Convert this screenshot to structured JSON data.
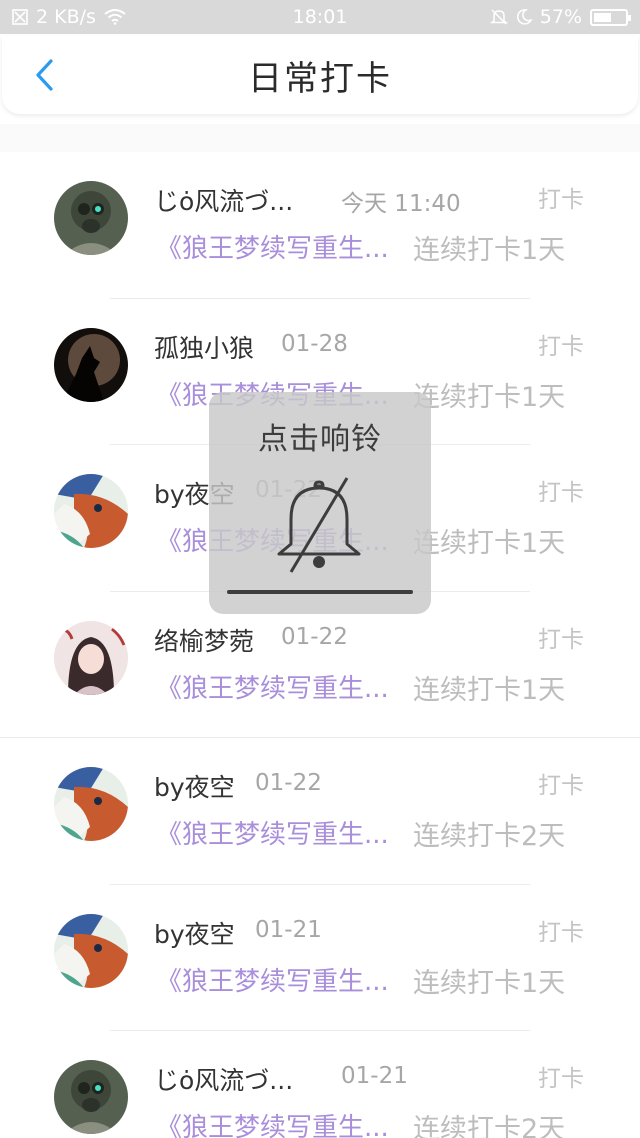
{
  "status_bar": {
    "network_speed": "2 KB/s",
    "time": "18:01",
    "battery_percent": "57%",
    "battery_level": 0.57,
    "icons": [
      "sim-off-icon",
      "wifi-icon",
      "bell-off-icon",
      "moon-icon",
      "battery-icon"
    ]
  },
  "header": {
    "title": "日常打卡",
    "back_icon": "chevron-left-icon",
    "accent_color": "#2a9bef"
  },
  "checkins": [
    {
      "name": "じȯ风流づ...",
      "time": "今天 11:40",
      "action": "打卡",
      "book": "《狼王梦续写重生...",
      "streak": "连续打卡1天",
      "avatar": "gasmask"
    },
    {
      "name": "孤独小狼",
      "time": "01-28",
      "action": "打卡",
      "book": "《狼王梦续写重生...",
      "streak": "连续打卡1天",
      "avatar": "wolf"
    },
    {
      "name": "by夜空",
      "time": "01-22",
      "action": "打卡",
      "book": "《狼王梦续写重生...",
      "streak": "连续打卡1天",
      "avatar": "dragon"
    },
    {
      "name": "络榆梦菀",
      "time": "01-22",
      "action": "打卡",
      "book": "《狼王梦续写重生...",
      "streak": "连续打卡1天",
      "avatar": "girl"
    },
    {
      "name": "by夜空",
      "time": "01-22",
      "action": "打卡",
      "book": "《狼王梦续写重生...",
      "streak": "连续打卡2天",
      "avatar": "dragon"
    },
    {
      "name": "by夜空",
      "time": "01-21",
      "action": "打卡",
      "book": "《狼王梦续写重生...",
      "streak": "连续打卡1天",
      "avatar": "dragon"
    },
    {
      "name": "じȯ风流づ...",
      "time": "01-21",
      "action": "打卡",
      "book": "《狼王梦续写重生...",
      "streak": "连续打卡2天",
      "avatar": "gasmask"
    }
  ],
  "toast": {
    "text": "点击响铃",
    "icon": "bell-muted-icon"
  },
  "colors": {
    "book_title": "#a98fdb",
    "streak": "#bdbdbd",
    "name": "#333333"
  }
}
